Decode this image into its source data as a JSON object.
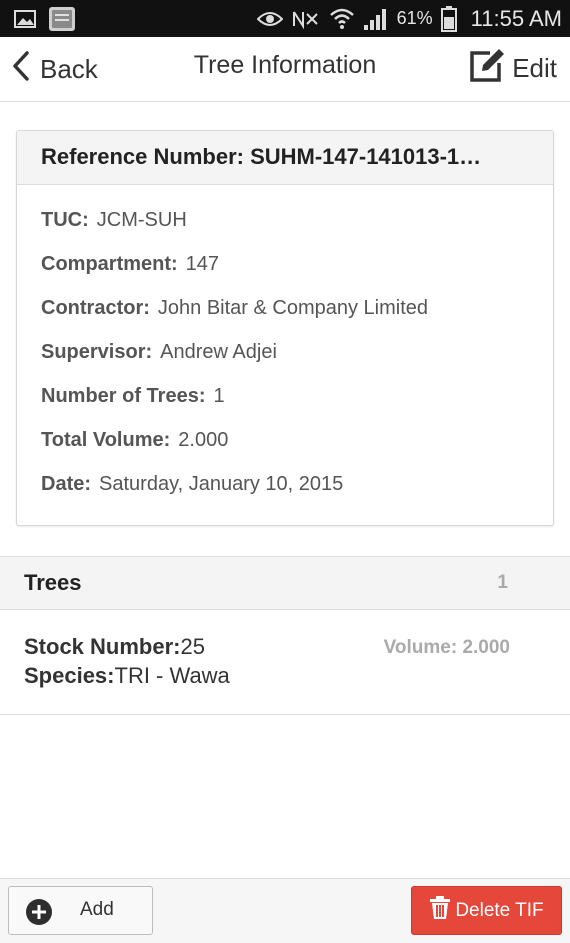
{
  "status_bar": {
    "battery_percent": "61%",
    "time": "11:55 AM",
    "icons": [
      "gallery-icon",
      "bible-app-icon",
      "eye-icon",
      "mute-nfc-icon",
      "wifi-icon",
      "signal-icon",
      "battery-icon"
    ]
  },
  "navbar": {
    "back_label": "Back",
    "title": "Tree Information",
    "edit_label": "Edit"
  },
  "info_card": {
    "reference": "Reference Number: SUHM-147-141013-1…",
    "fields": [
      {
        "label": "TUC:",
        "value": "JCM-SUH"
      },
      {
        "label": "Compartment:",
        "value": "147"
      },
      {
        "label": "Contractor:",
        "value": "John Bitar & Company Limited"
      },
      {
        "label": "Supervisor:",
        "value": "Andrew Adjei"
      },
      {
        "label": "Number of Trees:",
        "value": "1"
      },
      {
        "label": "Total Volume:",
        "value": "2.000"
      },
      {
        "label": "Date:",
        "value": "Saturday, January 10, 2015"
      }
    ]
  },
  "trees_section": {
    "title": "Trees",
    "count": "1",
    "items": [
      {
        "stock_label": "Stock Number:",
        "stock_value": "25",
        "species_label": "Species:",
        "species_value": "TRI - Wawa",
        "volume": "Volume: 2.000"
      }
    ]
  },
  "bottom_bar": {
    "add_label": "Add",
    "delete_label": "Delete TIF"
  },
  "colors": {
    "status_bar_bg": "#111111",
    "delete_button": "#e5473a",
    "header_bg": "#f4f4f4"
  }
}
